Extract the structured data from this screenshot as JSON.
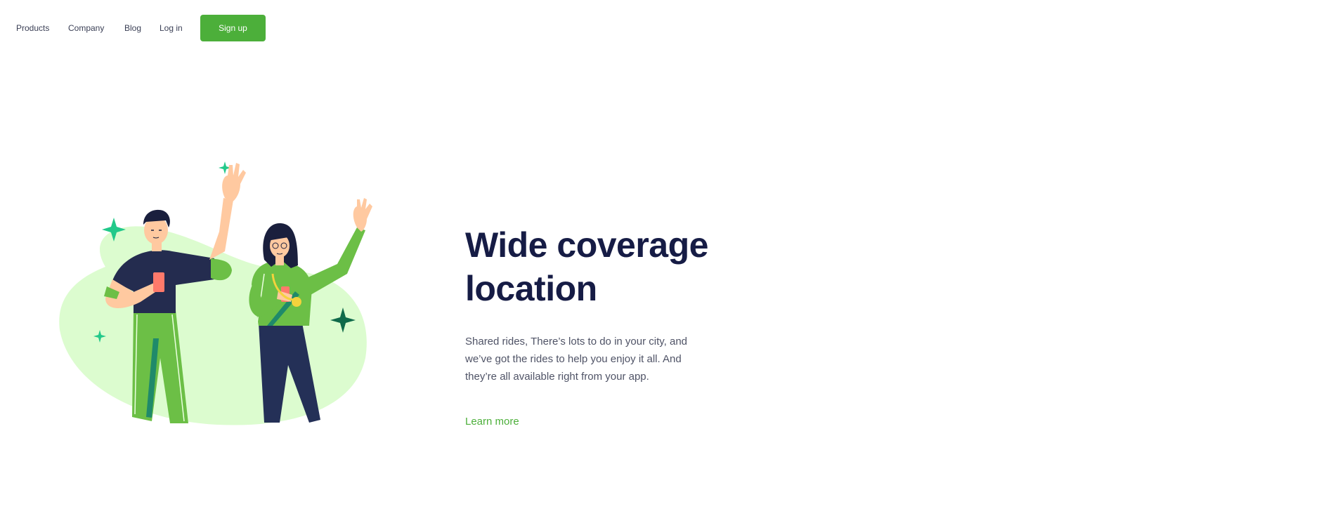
{
  "nav": {
    "products": "Products",
    "company": "Company",
    "blog": "Blog",
    "login": "Log in",
    "signup": "Sign up"
  },
  "hero": {
    "title_line1": "Wide coverage",
    "title_line2": "location",
    "description": "Shared rides, There’s lots to do in your city, and we’ve got the rides to help you enjoy it all. And they’re all available right from your app.",
    "cta": "Learn more"
  },
  "colors": {
    "accent": "#4caf3a",
    "heading": "#161c45",
    "blob": "#dcfccf",
    "sparkle": "#22c98a",
    "sparkle_dark": "#0f6a4a"
  }
}
